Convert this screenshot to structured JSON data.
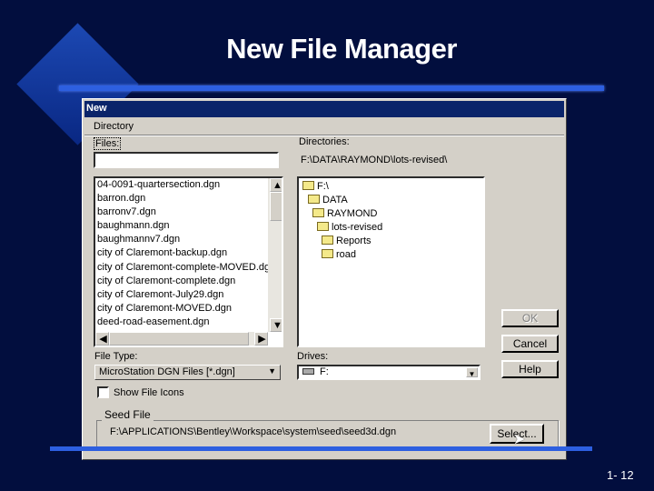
{
  "slide": {
    "title": "New File Manager",
    "page": "1- 12"
  },
  "dialog": {
    "title": "New",
    "menu": [
      "Directory"
    ],
    "files_label": "Files:",
    "files_input": "",
    "files": [
      "04-0091-quartersection.dgn",
      "barron.dgn",
      "barronv7.dgn",
      "baughmann.dgn",
      "baughmannv7.dgn",
      "city of Claremont-backup.dgn",
      "city of Claremont-complete-MOVED.dgn",
      "city of Claremont-complete.dgn",
      "city of Claremont-July29.dgn",
      "city of Claremont-MOVED.dgn",
      "deed-road-easement.dgn"
    ],
    "directories_label": "Directories:",
    "current_path": "F:\\DATA\\RAYMOND\\lots-revised\\",
    "tree": [
      {
        "label": "F:\\",
        "state": "open"
      },
      {
        "label": "DATA",
        "state": "open"
      },
      {
        "label": "RAYMOND",
        "state": "open"
      },
      {
        "label": "lots-revised",
        "state": "open-selected"
      },
      {
        "label": "Reports",
        "state": "closed"
      },
      {
        "label": "road",
        "state": "closed"
      }
    ],
    "ok": "OK",
    "cancel": "Cancel",
    "help": "Help",
    "file_type_label": "File Type:",
    "file_type": "MicroStation DGN Files [*.dgn]",
    "drives_label": "Drives:",
    "drive": "F:",
    "show_icons": "Show File Icons",
    "show_icons_checked": false,
    "seed_label": "Seed File",
    "seed_path": "F:\\APPLICATIONS\\Bentley\\Workspace\\system\\seed\\seed3d.dgn",
    "select": "Select..."
  }
}
